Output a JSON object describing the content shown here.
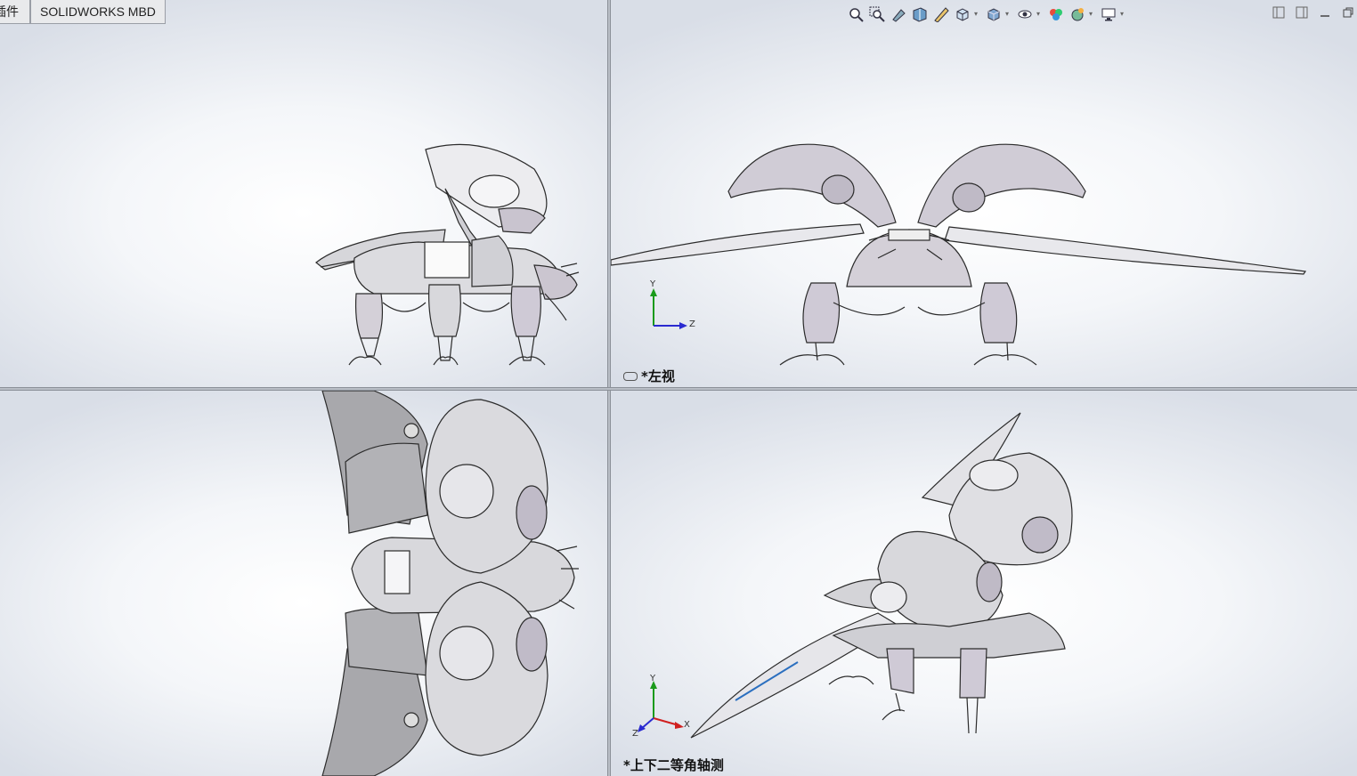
{
  "tabs": [
    {
      "label": "插件"
    },
    {
      "label": "SOLIDWORKS MBD"
    }
  ],
  "hud_icons": [
    "zoom-to-fit-icon",
    "zoom-to-area-icon",
    "previous-view-icon",
    "section-view-icon",
    "dynamic-annotation-icon",
    "view-orientation-icon",
    "display-style-icon",
    "hide-show-items-icon",
    "edit-appearance-icon",
    "apply-scene-icon",
    "view-settings-icon"
  ],
  "viewports": {
    "top_right": {
      "view_name": "*左视",
      "triad": {
        "y": "Y",
        "z": "Z"
      }
    },
    "bottom_right": {
      "view_name": "*上下二等角轴测",
      "triad": {
        "y": "Y",
        "x": "X",
        "z": "Z"
      }
    }
  },
  "colors": {
    "triad_y": "#1a9a1a",
    "triad_z": "#2a2ad0",
    "triad_x": "#d02020",
    "model_line": "#2b2b2b",
    "model_fill": "#d8d8dc",
    "model_shade": "#b9b2c2"
  }
}
